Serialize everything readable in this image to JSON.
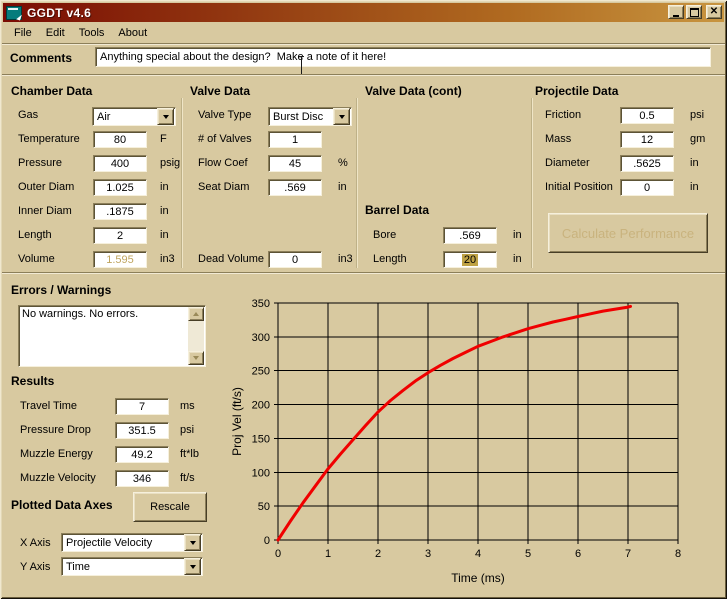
{
  "window": {
    "title": "GGDT v4.6"
  },
  "icons": {
    "app": "form-icon",
    "minimize": "minimize-bar",
    "maximize": "maximize-box",
    "close": "✕",
    "dropdown": "▼",
    "scroll_up": "▲",
    "scroll_down": "▼"
  },
  "menu": {
    "items": [
      {
        "label": "File",
        "underline": 0
      },
      {
        "label": "Edit",
        "underline": 0
      },
      {
        "label": "Tools",
        "underline": 0
      },
      {
        "label": "About",
        "underline": 0
      }
    ]
  },
  "comments": {
    "label": "Comments",
    "value": "Anything special about the design?  Make a note of it here!"
  },
  "sections": {
    "chamber": {
      "title": "Chamber Data",
      "rows": [
        {
          "label": "Gas",
          "kind": "select",
          "value": "Air",
          "slot": 0
        },
        {
          "label": "Temperature",
          "kind": "input",
          "value": "80",
          "unit": "F",
          "slot": 1
        },
        {
          "label": "Pressure",
          "kind": "input",
          "value": "400",
          "unit": "psig",
          "slot": 2
        },
        {
          "label": "Outer Diam",
          "kind": "input",
          "value": "1.025",
          "unit": "in",
          "slot": 3
        },
        {
          "label": "Inner Diam",
          "kind": "input",
          "value": ".1875",
          "unit": "in",
          "slot": 4
        },
        {
          "label": "Length",
          "kind": "input",
          "value": "2",
          "unit": "in",
          "slot": 5
        },
        {
          "label": "Volume",
          "kind": "readonly",
          "value": "1.595",
          "unit": "in3",
          "slot": 6
        }
      ]
    },
    "valve": {
      "title": "Valve Data",
      "rows": [
        {
          "label": "Valve Type",
          "kind": "select",
          "value": "Burst Disc",
          "slot": 0
        },
        {
          "label": "# of Valves",
          "kind": "input",
          "value": "1",
          "slot": 1
        },
        {
          "label": "Flow Coef",
          "kind": "input",
          "value": "45",
          "unit": "%",
          "slot": 2
        },
        {
          "label": "Seat Diam",
          "kind": "input",
          "value": ".569",
          "unit": "in",
          "slot": 3
        },
        {
          "label": "Dead Volume",
          "kind": "input",
          "value": "0",
          "unit": "in3",
          "slot": 6
        }
      ]
    },
    "valve_cont": {
      "title": "Valve Data (cont)",
      "rows": []
    },
    "barrel": {
      "title": "Barrel Data",
      "rows": [
        {
          "label": "Bore",
          "kind": "input",
          "value": ".569",
          "unit": "in",
          "slot": 5
        },
        {
          "label": "Length",
          "kind": "input",
          "value": "20",
          "unit": "in",
          "slot": 6,
          "selected": true
        }
      ]
    },
    "projectile": {
      "title": "Projectile Data",
      "rows": [
        {
          "label": "Friction",
          "kind": "input",
          "value": "0.5",
          "unit": "psi",
          "slot": 0
        },
        {
          "label": "Mass",
          "kind": "input",
          "value": "12",
          "unit": "gm",
          "slot": 1
        },
        {
          "label": "Diameter",
          "kind": "input",
          "value": ".5625",
          "unit": "in",
          "slot": 2
        },
        {
          "label": "Initial Position",
          "kind": "input",
          "value": "0",
          "unit": "in",
          "slot": 3
        }
      ]
    },
    "results": {
      "title": "Results",
      "rows": [
        {
          "label": "Travel Time",
          "kind": "input",
          "value": "7",
          "unit": "ms",
          "slot": 0
        },
        {
          "label": "Pressure Drop",
          "kind": "input",
          "value": "351.5",
          "unit": "psi",
          "slot": 1
        },
        {
          "label": "Muzzle Energy",
          "kind": "input",
          "value": "49.2",
          "unit": "ft*lb",
          "slot": 2
        },
        {
          "label": "Muzzle Velocity",
          "kind": "input",
          "value": "346",
          "unit": "ft/s",
          "slot": 3
        }
      ]
    }
  },
  "buttons": {
    "calculate": "Calculate Performance",
    "rescale": "Rescale"
  },
  "errors": {
    "title": "Errors / Warnings",
    "text": "No warnings.  No errors."
  },
  "plotted": {
    "title": "Plotted Data Axes",
    "x_axis_label": "X Axis",
    "x_axis_value": "Projectile Velocity",
    "y_axis_label": "Y Axis",
    "y_axis_value": "Time"
  },
  "chart_data": {
    "type": "line",
    "title": "",
    "xlabel": "Time (ms)",
    "ylabel": "Proj Vel (ft/s)",
    "xlim": [
      0,
      8
    ],
    "ylim": [
      0,
      350
    ],
    "xticks": [
      0,
      1,
      2,
      3,
      4,
      5,
      6,
      7,
      8
    ],
    "yticks": [
      0,
      50,
      100,
      150,
      200,
      250,
      300,
      350
    ],
    "grid": true,
    "legend": false,
    "line_color": "#f00000",
    "series": [
      {
        "name": "Projectile Velocity vs Time",
        "x": [
          0,
          0.25,
          0.5,
          0.75,
          1,
          1.25,
          1.5,
          1.75,
          2,
          2.25,
          2.5,
          2.75,
          3,
          3.25,
          3.5,
          3.75,
          4,
          4.25,
          4.5,
          4.75,
          5,
          5.25,
          5.5,
          5.75,
          6,
          6.25,
          6.5,
          6.75,
          7,
          7.05
        ],
        "y": [
          0,
          28,
          55,
          80,
          105,
          127,
          148,
          169,
          189,
          206,
          221,
          235,
          247,
          258,
          268,
          277,
          286,
          293,
          300,
          306,
          312,
          317,
          322,
          326,
          330,
          334,
          338,
          341,
          344,
          345
        ]
      }
    ]
  },
  "colors": {
    "background": "#d8c9a0",
    "titlebar_left": "#7a0b03",
    "titlebar_right": "#c89540",
    "line_red": "#f00000",
    "disabled_text": "#c9b37e",
    "selection": "#bfa244"
  }
}
